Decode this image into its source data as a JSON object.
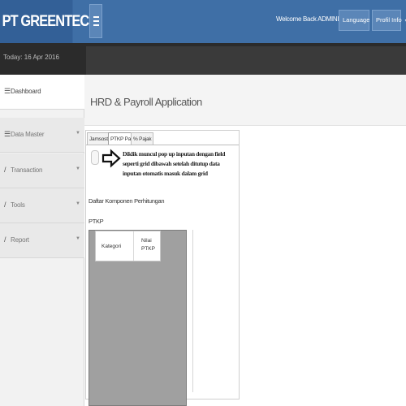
{
  "header": {
    "brand": "PT GREENTECH",
    "welcome": "Welcome Back ADMINISTRATOR",
    "language_label": "Language",
    "profile_label": "Profil Info",
    "menu_icon": "hamburger-icon",
    "colors": {
      "header": "#3f6fa6",
      "brand": "#336097",
      "datebar": "#2b2b2b"
    }
  },
  "datebar": {
    "date": "Today: 16 Apr 2016"
  },
  "sidebar": {
    "items": [
      {
        "label": "Dashboard",
        "icon": "list-icon"
      },
      {
        "label": "Data Master",
        "icon": "list-icon"
      },
      {
        "label": "Transaction",
        "icon": "pencil-icon"
      },
      {
        "label": "Tools",
        "icon": "pencil-icon"
      },
      {
        "label": "Report",
        "icon": "pencil-icon"
      }
    ]
  },
  "main": {
    "title": "HRD & Payroll Application",
    "tabs": [
      {
        "label": "Jamsostek"
      },
      {
        "label": "PTKP Pajak"
      },
      {
        "label": "% Pajak"
      }
    ],
    "annotation": "Diklik muncul pop up inputan dengan field seperti grid dibawah setelah ditutup data inputan otomatis masuk dalam grid",
    "section_title": "Daftar Komponen Perhitungan",
    "subsection": "PTKP",
    "grid": {
      "columns": [
        "Kategori",
        "Nilai\nPTKP"
      ]
    }
  }
}
